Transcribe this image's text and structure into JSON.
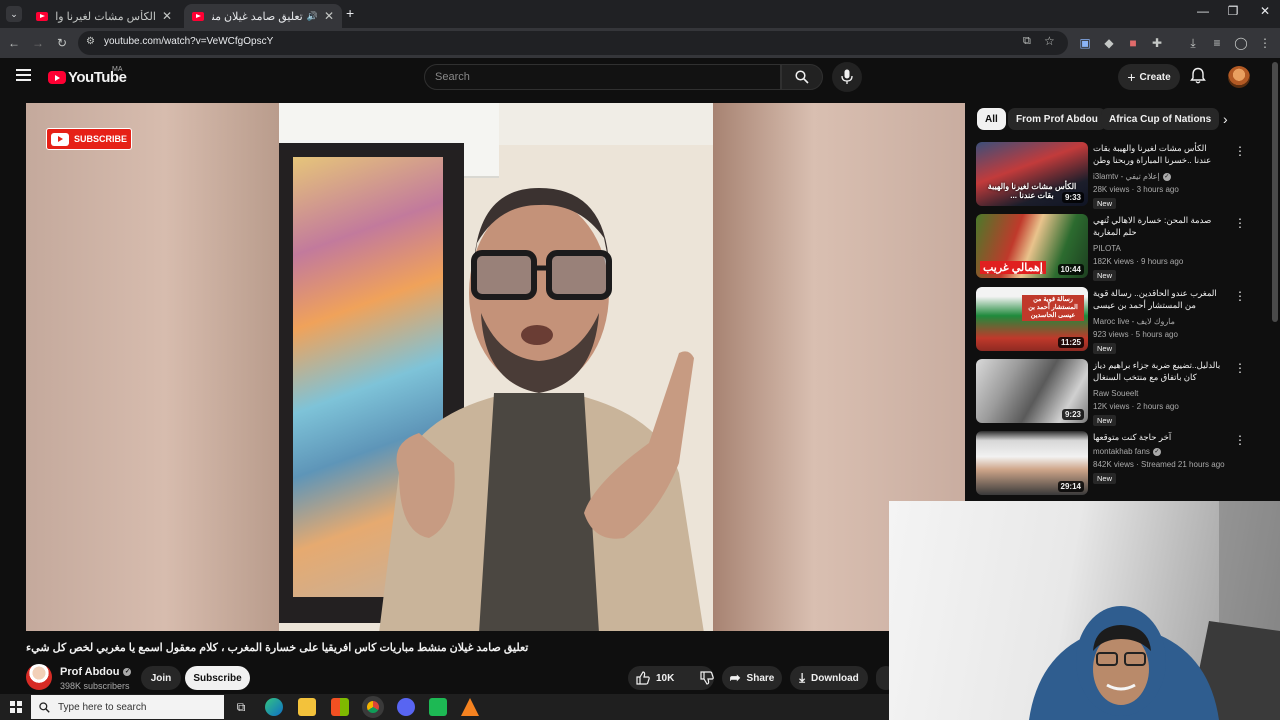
{
  "browser": {
    "tabs": [
      {
        "title": "الكأس مشات لغيرنا والهيبة بقات",
        "active": false
      },
      {
        "title": "تعليق صامد غيلان منشط مبا",
        "active": true
      }
    ],
    "url": "youtube.com/watch?v=VeWCfgOpscY",
    "window_controls": [
      "—",
      "❐",
      "✕"
    ]
  },
  "masthead": {
    "logo_text": "YouTube",
    "country_code": "MA",
    "search_placeholder": "Search",
    "create_label": "Create"
  },
  "player": {
    "overlay_subscribe_label": "SUBSCRIBE"
  },
  "video": {
    "title": "تعليق صامد غيلان منشط مباريات كاس افريقيا على خسارة المغرب ، كلام معقول اسمع يا مغربي لخص كل شيء",
    "channel_name": "Prof Abdou",
    "subscribers": "398K subscribers",
    "join_label": "Join",
    "subscribe_label": "Subscribe",
    "likes": "10K",
    "share_label": "Share",
    "download_label": "Download"
  },
  "sidebar": {
    "chips": [
      {
        "label": "All",
        "active": true
      },
      {
        "label": "From Prof Abdou",
        "active": false
      },
      {
        "label": "Africa Cup of Nations",
        "active": false
      }
    ],
    "recommendations": [
      {
        "title": "الكأس مشات لغيرنا والهيبة بقات عندنا ..خسرنا المباراة وربحنا وطن",
        "thumb_text": "الكأس مشات لغيرنا والهيبة بقات عندنا ...",
        "duration": "9:33",
        "channel": "i3lamtv - إعلام تيفي",
        "verified": true,
        "meta": "28K views · 3 hours ago",
        "badge": "New"
      },
      {
        "title": "صدمة المحن: خسارة الاهالي تُنهي حلم المغاربة",
        "thumb_text": "إهمالي غريب",
        "duration": "10:44",
        "channel": "PILOTA",
        "verified": false,
        "meta": "182K views · 9 hours ago",
        "badge": "New"
      },
      {
        "title": "المغرب عندو الحاقدين.. رسالة قوية من المستشار أحمد بن عيسى",
        "thumb_text": "رسالة قوية من المستشار أحمد بن عيسى الحاسدين",
        "duration": "11:25",
        "channel": "Maroc live - ماروك لايف",
        "verified": false,
        "meta": "923 views · 5 hours ago",
        "badge": "New"
      },
      {
        "title": "بالدليل..تضييع ضربة جزاء براهيم دياز كان باتفاق مع منتخب السنغال",
        "thumb_text": "",
        "duration": "9:23",
        "channel": "Raw Soueelt",
        "verified": false,
        "meta": "12K views · 2 hours ago",
        "badge": "New"
      },
      {
        "title": "آخر حاجة كنت متوقعها",
        "thumb_text": "",
        "duration": "29:14",
        "channel": "montakhab fans",
        "verified": true,
        "meta": "842K views · Streamed 21 hours ago",
        "badge": "New"
      }
    ]
  },
  "taskbar": {
    "search_placeholder": "Type here to search"
  },
  "colors": {
    "background": "#0f0f0f",
    "brand_red": "#ff0033",
    "chip_bg": "#272727",
    "text_primary": "#f1f1f1",
    "text_secondary": "#aaaaaa"
  }
}
